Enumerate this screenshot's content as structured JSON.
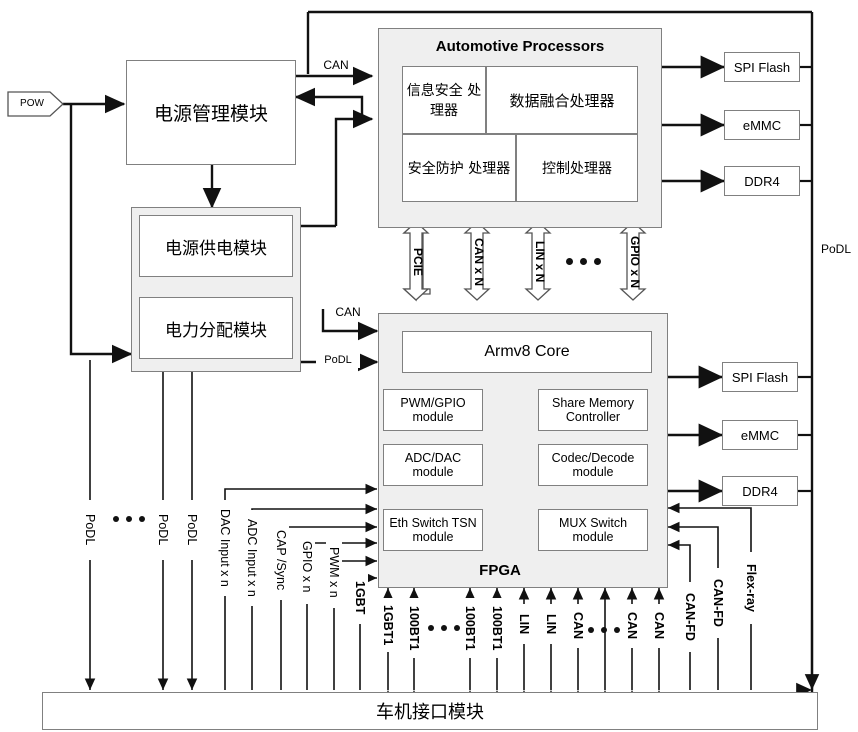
{
  "diagram": {
    "title": "车机接口模块",
    "source_tag": "POW"
  },
  "power": {
    "management": "电源管理模块",
    "supply": "电源供电模块",
    "distribution": "电力分配模块"
  },
  "processors": {
    "title": "Automotive Processors",
    "blocks": [
      {
        "label": "信息安全\n处理器"
      },
      {
        "label": "数据融合处理器"
      },
      {
        "label": "安全防护\n处理器"
      },
      {
        "label": "控制处理器"
      }
    ]
  },
  "fpga": {
    "title": "FPGA",
    "core": "Armv8 Core",
    "modules": [
      {
        "label": "PWM/GPIO\nmodule"
      },
      {
        "label": "Share Memory\nController"
      },
      {
        "label": "ADC/DAC\nmodule"
      },
      {
        "label": "Codec/Decode\nmodule"
      },
      {
        "label": "Eth Switch\nTSN  module"
      },
      {
        "label": "MUX Switch\nmodule"
      }
    ]
  },
  "memories_top": [
    {
      "label": "SPI Flash"
    },
    {
      "label": "eMMC"
    },
    {
      "label": "DDR4"
    }
  ],
  "memories_bottom": [
    {
      "label": "SPI Flash"
    },
    {
      "label": "eMMC"
    },
    {
      "label": "DDR4"
    }
  ],
  "bus_arrows": [
    {
      "label": "PCIE"
    },
    {
      "label": "CAN x N"
    },
    {
      "label": "LIN x N"
    },
    {
      "label": "GPIO x N"
    }
  ],
  "link_labels": {
    "can_top": "CAN",
    "can_fpga": "CAN",
    "podl_fpga": "PoDL",
    "podl_right": "PoDL"
  },
  "bottom_signals": [
    {
      "label": "PoDL"
    },
    {
      "label": "PoDL"
    },
    {
      "label": "PoDL"
    },
    {
      "label": "DAC Input x n"
    },
    {
      "label": "ADC Input x n"
    },
    {
      "label": "CAP /Sync"
    },
    {
      "label": "GPIO x n"
    },
    {
      "label": "PWM x n"
    },
    {
      "label": "1GBT"
    },
    {
      "label": "1GBT1"
    },
    {
      "label": "100BT1"
    },
    {
      "label": "100BT1"
    },
    {
      "label": "100BT1"
    },
    {
      "label": "LIN"
    },
    {
      "label": "LIN"
    },
    {
      "label": "CAN"
    },
    {
      "label": "CAN"
    },
    {
      "label": "CAN"
    },
    {
      "label": "CAN-FD"
    },
    {
      "label": "CAN-FD"
    },
    {
      "label": "Flex-ray"
    }
  ]
}
